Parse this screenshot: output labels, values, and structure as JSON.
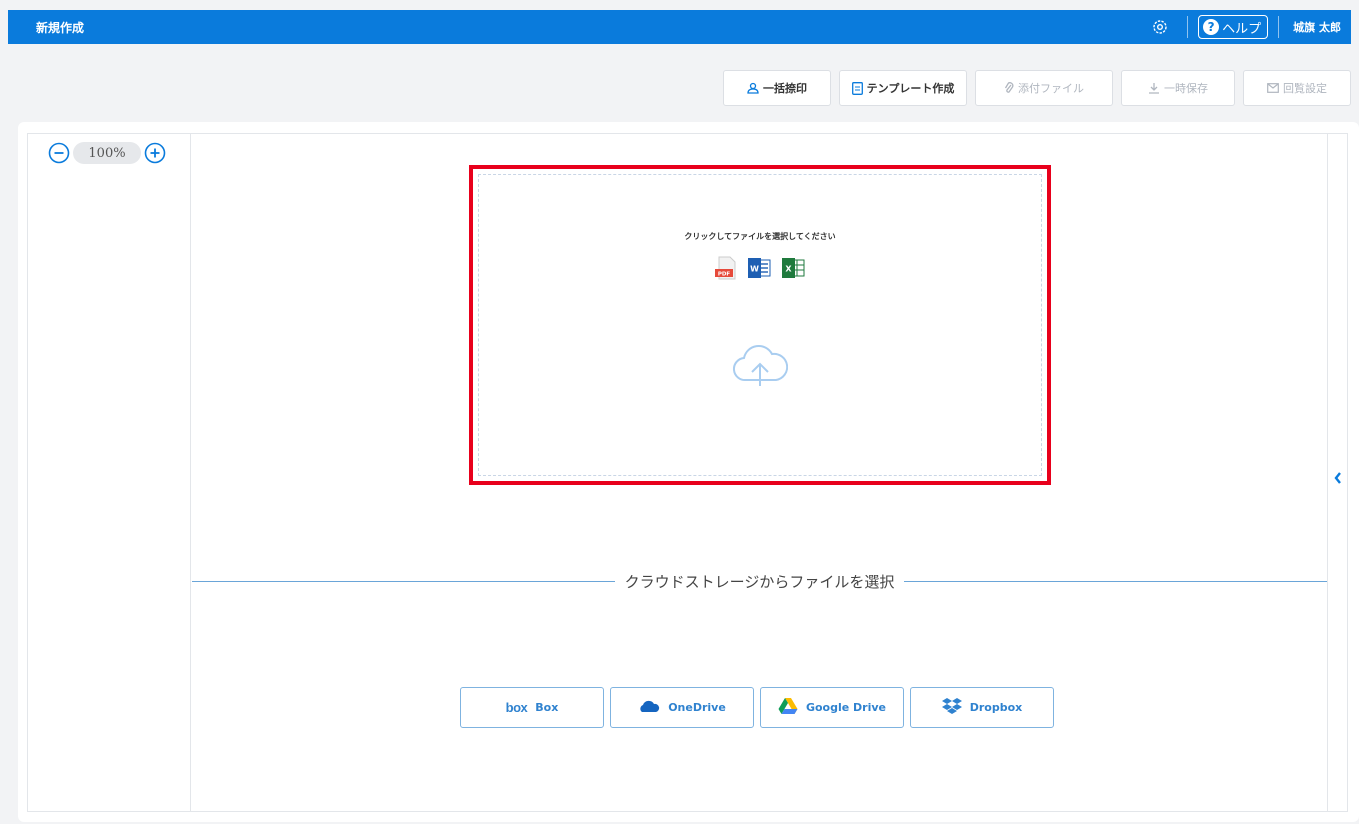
{
  "header": {
    "title": "新規作成",
    "help_label": "ヘルプ",
    "help_mark": "?",
    "user_name": "城旗 太郎"
  },
  "toolbar": {
    "bulk_stamp": "一括捺印",
    "template": "テンプレート作成",
    "attach": "添付ファイル",
    "temp_save": "一時保存",
    "circulation": "回覧設定"
  },
  "zoom": {
    "value": "100%"
  },
  "dropzone": {
    "instruction": "クリックしてファイルを選択してください",
    "file_types": [
      "PDF",
      "W",
      "X"
    ]
  },
  "cloud": {
    "heading": "クラウドストレージからファイルを選択",
    "box_logo": "box",
    "services": [
      "Box",
      "OneDrive",
      "Google Drive",
      "Dropbox"
    ]
  },
  "colors": {
    "brand": "#0a7bdc",
    "highlight": "#e8001c",
    "pdf": "#e64a3b",
    "word": "#1e5fb3",
    "excel": "#1f7a3d"
  }
}
